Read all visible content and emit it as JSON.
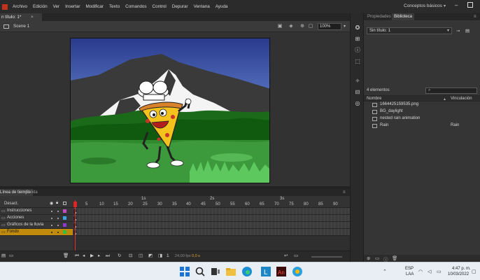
{
  "menubar": {
    "items": [
      "Archivo",
      "Edición",
      "Ver",
      "Insertar",
      "Modificar",
      "Texto",
      "Comandos",
      "Control",
      "Depurar",
      "Ventana",
      "Ayuda"
    ],
    "workspace": "Conceptos básicos"
  },
  "document": {
    "tab_title": "n título: 1*",
    "scene": "Scene 1",
    "zoom": "100%"
  },
  "timeline": {
    "tabs": [
      "Línea de tiempo",
      "Salida"
    ],
    "layers_header": "Desact.",
    "layers": [
      {
        "name": "Instrucciones",
        "color": "#c24dc2",
        "active": false
      },
      {
        "name": "Acciones",
        "color": "#3aa8e0",
        "active": false
      },
      {
        "name": "Gráficos de la lluvia",
        "color": "#8a3bd0",
        "active": false
      },
      {
        "name": "Fondo",
        "color": "#2fbf3c",
        "active": true
      }
    ],
    "seconds": [
      "1s",
      "2s",
      "3s"
    ],
    "frame_numbers": [
      "1",
      "5",
      "10",
      "15",
      "20",
      "25",
      "30",
      "35",
      "40",
      "45",
      "50",
      "55",
      "60",
      "65",
      "70",
      "75",
      "80",
      "85",
      "90"
    ],
    "fps": "24,00 fps",
    "time": "0,0 s",
    "current_frame": "1"
  },
  "library": {
    "tabs": [
      "Propiedades",
      "Biblioteca"
    ],
    "doc": "Sin título: 1",
    "count": "4 elementos",
    "col_name": "Nombre",
    "col_link": "Vinculación",
    "items": [
      {
        "name": "1664425159535.png",
        "link": "",
        "icon": "bitmap-icon"
      },
      {
        "name": "BG_daylight",
        "link": "",
        "icon": "movieclip-icon"
      },
      {
        "name": "nested rain animation",
        "link": "",
        "icon": "movieclip-icon"
      },
      {
        "name": "Rain",
        "link": "Rain",
        "icon": "movieclip-icon"
      }
    ]
  },
  "taskbar": {
    "lang_top": "ESP",
    "lang_bottom": "LAA",
    "time": "4:47 p. m.",
    "date": "10/03/2022"
  }
}
